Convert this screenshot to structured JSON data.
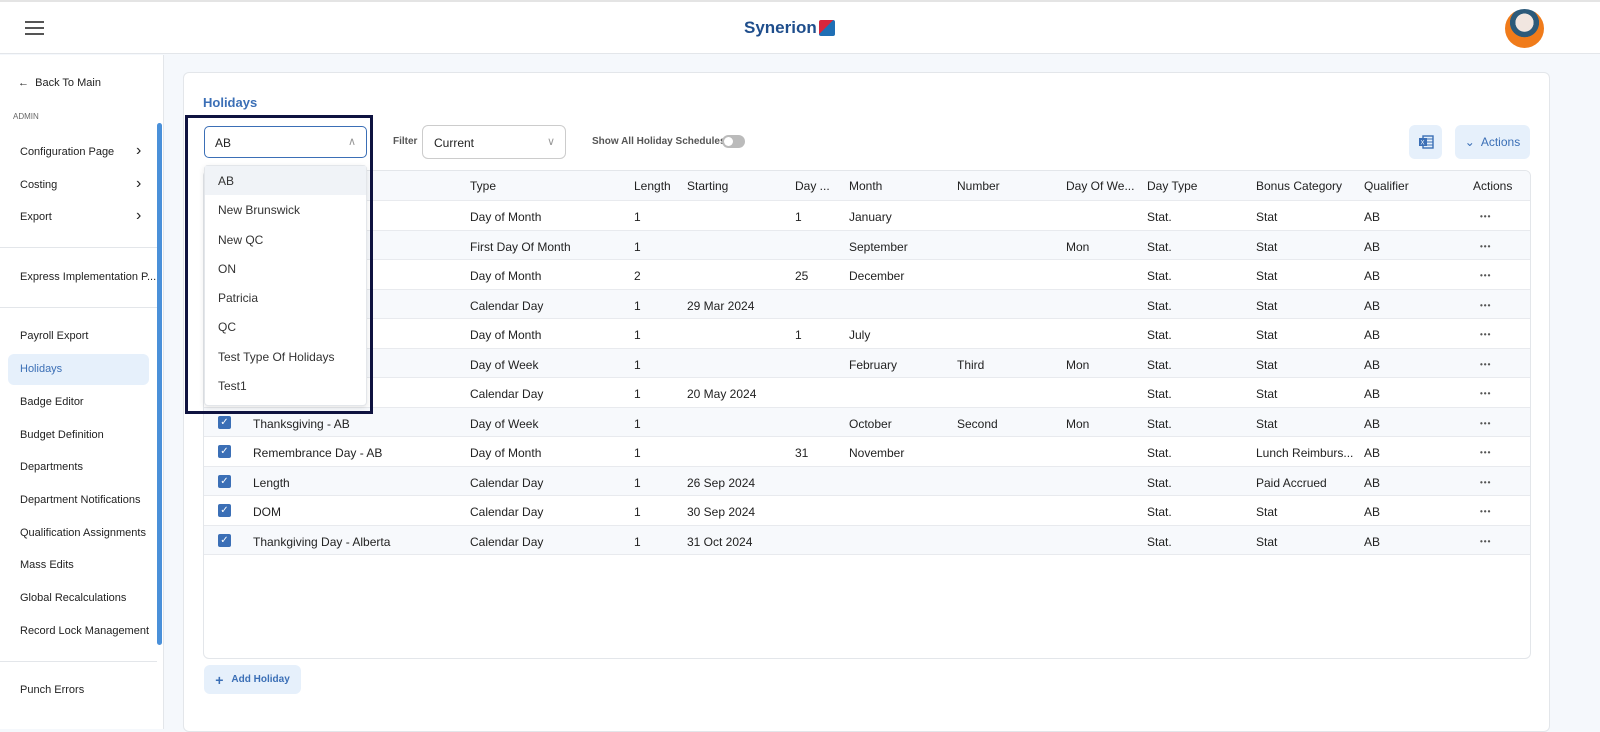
{
  "header": {
    "brand": "Synerion",
    "avatar": "user-avatar"
  },
  "sidebar": {
    "back": "Back To Main",
    "section": "ADMIN",
    "items": [
      {
        "label": "Configuration Page",
        "chevron": true
      },
      {
        "label": "Costing",
        "chevron": true
      },
      {
        "label": "Export",
        "chevron": true
      },
      {
        "label": "Express Implementation P..."
      },
      {
        "label": "Payroll Export"
      },
      {
        "label": "Holidays",
        "active": true
      },
      {
        "label": "Badge Editor"
      },
      {
        "label": "Budget Definition"
      },
      {
        "label": "Departments"
      },
      {
        "label": "Department Notifications"
      },
      {
        "label": "Qualification Assignments"
      },
      {
        "label": "Mass Edits"
      },
      {
        "label": "Global Recalculations"
      },
      {
        "label": "Record Lock Management"
      },
      {
        "label": "Punch Errors"
      }
    ]
  },
  "main": {
    "title": "Holidays",
    "schedule_select": {
      "value": "AB",
      "options": [
        "AB",
        "New Brunswick",
        "New QC",
        "ON",
        "Patricia",
        "QC",
        "Test Type Of Holidays",
        "Test1"
      ]
    },
    "filter": {
      "label": "Filter",
      "value": "Current"
    },
    "show_all": {
      "label": "Show All Holiday Schedules",
      "on": false
    },
    "actions_label": "Actions",
    "add_label": "Add Holiday",
    "table": {
      "columns": [
        "",
        "Type",
        "Length",
        "Starting",
        "Day ...",
        "Month",
        "Number",
        "Day Of We...",
        "Day Type",
        "Bonus Category",
        "Qualifier",
        "Actions"
      ],
      "rows": [
        [
          "",
          "Day of Month",
          "1",
          "",
          "1",
          "January",
          "",
          "",
          "Stat.",
          "Stat",
          "AB"
        ],
        [
          "",
          "First Day Of Month",
          "1",
          "",
          "",
          "September",
          "",
          "Mon",
          "Stat.",
          "Stat",
          "AB"
        ],
        [
          "",
          "Day of Month",
          "2",
          "",
          "25",
          "December",
          "",
          "",
          "Stat.",
          "Stat",
          "AB"
        ],
        [
          "",
          "Calendar Day",
          "1",
          "29 Mar 2024",
          "",
          "",
          "",
          "",
          "Stat.",
          "Stat",
          "AB"
        ],
        [
          "",
          "Day of Month",
          "1",
          "",
          "1",
          "July",
          "",
          "",
          "Stat.",
          "Stat",
          "AB"
        ],
        [
          "",
          "Day of Week",
          "1",
          "",
          "",
          "February",
          "Third",
          "Mon",
          "Stat.",
          "Stat",
          "AB"
        ],
        [
          "",
          "Calendar Day",
          "1",
          "20 May 2024",
          "",
          "",
          "",
          "",
          "Stat.",
          "Stat",
          "AB"
        ],
        [
          "Thanksgiving - AB",
          "Day of Week",
          "1",
          "",
          "",
          "October",
          "Second",
          "Mon",
          "Stat.",
          "Stat",
          "AB"
        ],
        [
          "Remembrance Day - AB",
          "Day of Month",
          "1",
          "",
          "31",
          "November",
          "",
          "",
          "Stat.",
          "Lunch Reimburs...",
          "AB"
        ],
        [
          "Length",
          "Calendar Day",
          "1",
          "26 Sep 2024",
          "",
          "",
          "",
          "",
          "Stat.",
          "Paid Accrued",
          "AB"
        ],
        [
          "DOM",
          "Calendar Day",
          "1",
          "30 Sep 2024",
          "",
          "",
          "",
          "",
          "Stat.",
          "Stat",
          "AB"
        ],
        [
          "Thankgiving Day - Alberta",
          "Calendar Day",
          "1",
          "31 Oct 2024",
          "",
          "",
          "",
          "",
          "Stat.",
          "Stat",
          "AB"
        ]
      ]
    }
  },
  "colors": {
    "accent": "#3b6fb6",
    "highlight_border": "#0f1340",
    "light_button": "#e6f0fb"
  }
}
